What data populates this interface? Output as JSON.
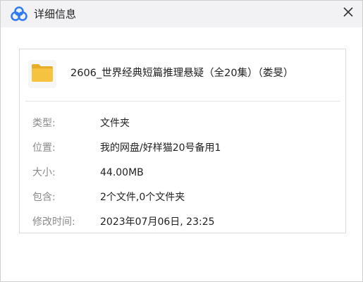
{
  "window": {
    "title": "详细信息"
  },
  "icons": {
    "app": "baidu-netdisk-cloud-icon",
    "close": "close-icon",
    "file": "folder-icon"
  },
  "colors": {
    "folder_fill": "#f5c33f",
    "folder_tab": "#e8ad28",
    "logo_blue": "#2f7cf6"
  },
  "file": {
    "name": "2606_世界经典短篇推理悬疑（全20集）（娄旻）"
  },
  "details": [
    {
      "label": "类型:",
      "value": "文件夹"
    },
    {
      "label": "位置:",
      "value": "我的网盘/好样猫20号备用1"
    },
    {
      "label": "大小:",
      "value": "44.00MB"
    },
    {
      "label": "包含:",
      "value": "2个文件,0个文件夹"
    },
    {
      "label": "修改时间:",
      "value": "2023年07月06日, 23:25"
    }
  ]
}
